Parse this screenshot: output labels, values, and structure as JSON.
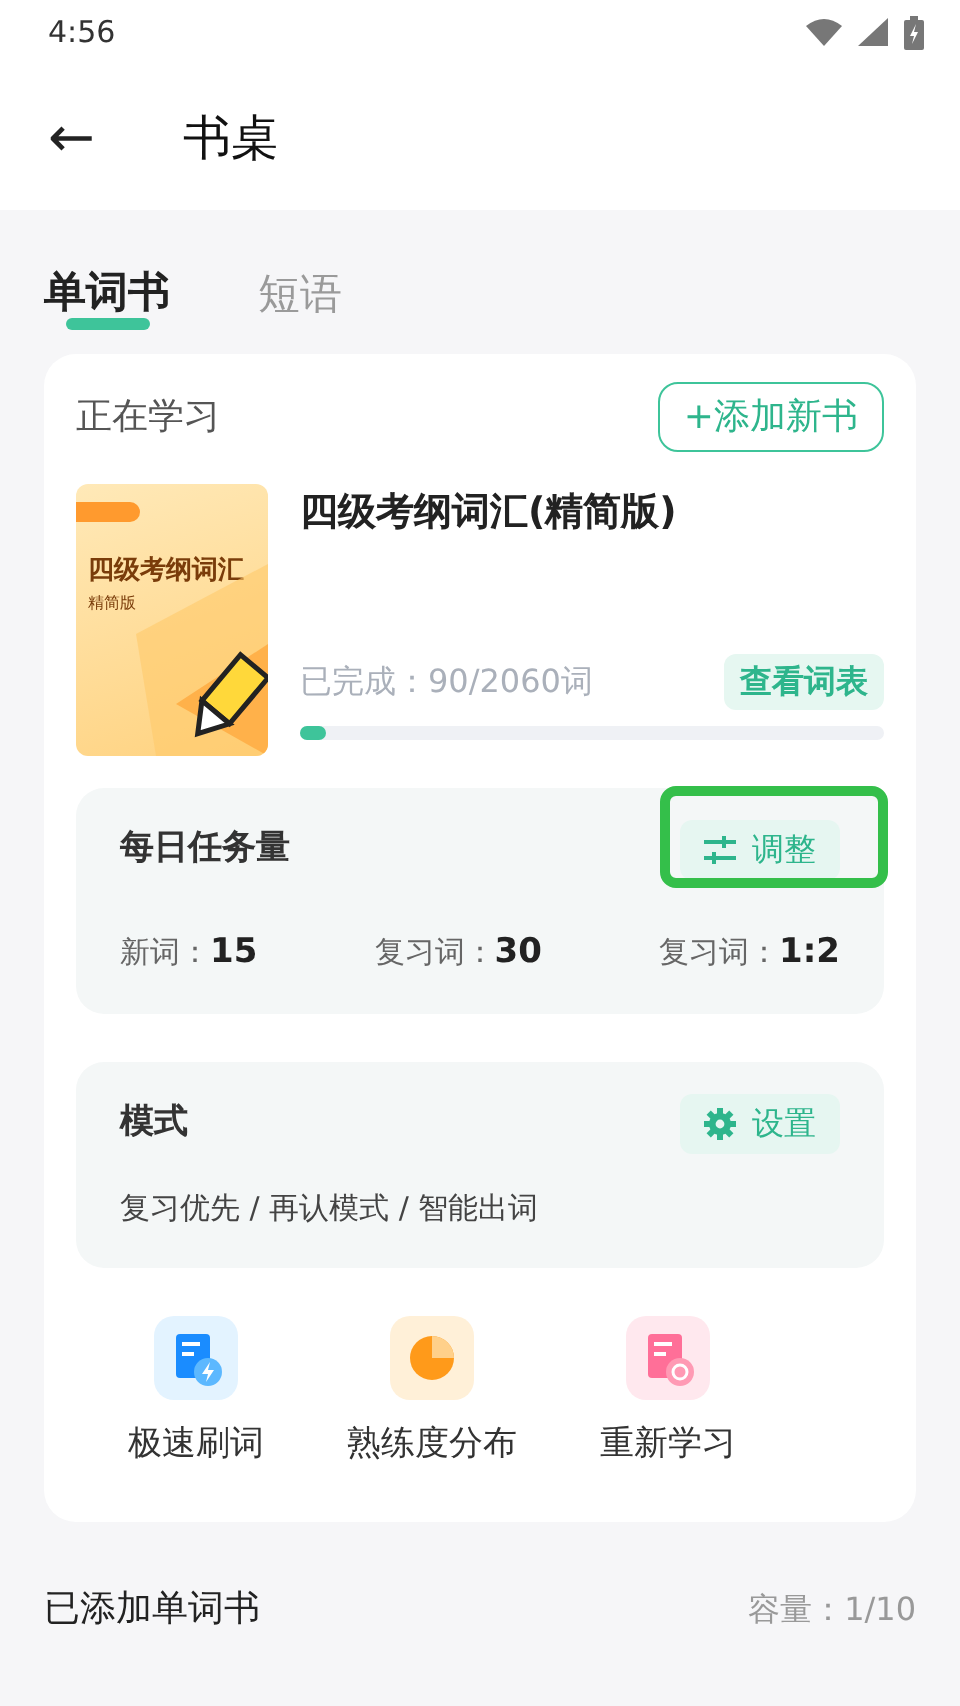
{
  "status_bar": {
    "time": "4:56"
  },
  "header": {
    "back_icon": "←",
    "title": "书桌"
  },
  "tabs": [
    {
      "label": "单词书",
      "selected": true
    },
    {
      "label": "短语",
      "selected": false
    }
  ],
  "studying": {
    "label": "正在学习",
    "add_button": "+添加新书",
    "book": {
      "cover_title": "四级考纲词汇",
      "cover_subtitle": "精简版",
      "title": "四级考纲词汇(精简版)",
      "progress_text": "已完成：90/2060词",
      "level": 0.044,
      "view_button": "查看词表"
    }
  },
  "daily_task": {
    "title": "每日任务量",
    "button": {
      "label": "调整",
      "highlighted": true
    },
    "stats": [
      {
        "label": "新词：",
        "value": "15"
      },
      {
        "label": "复习词：",
        "value": "30"
      },
      {
        "label": "复习词：",
        "value": "1:2"
      }
    ]
  },
  "mode": {
    "title": "模式",
    "button": "设置",
    "summary": "复习优先 / 再认模式 / 智能出词"
  },
  "actions": [
    {
      "kind": "speed",
      "label": "极速刷词"
    },
    {
      "kind": "chart",
      "label": "熟练度分布"
    },
    {
      "kind": "restart",
      "label": "重新学习"
    }
  ],
  "added_books": {
    "title": "已添加单词书",
    "capacity": "容量：1/10"
  }
}
